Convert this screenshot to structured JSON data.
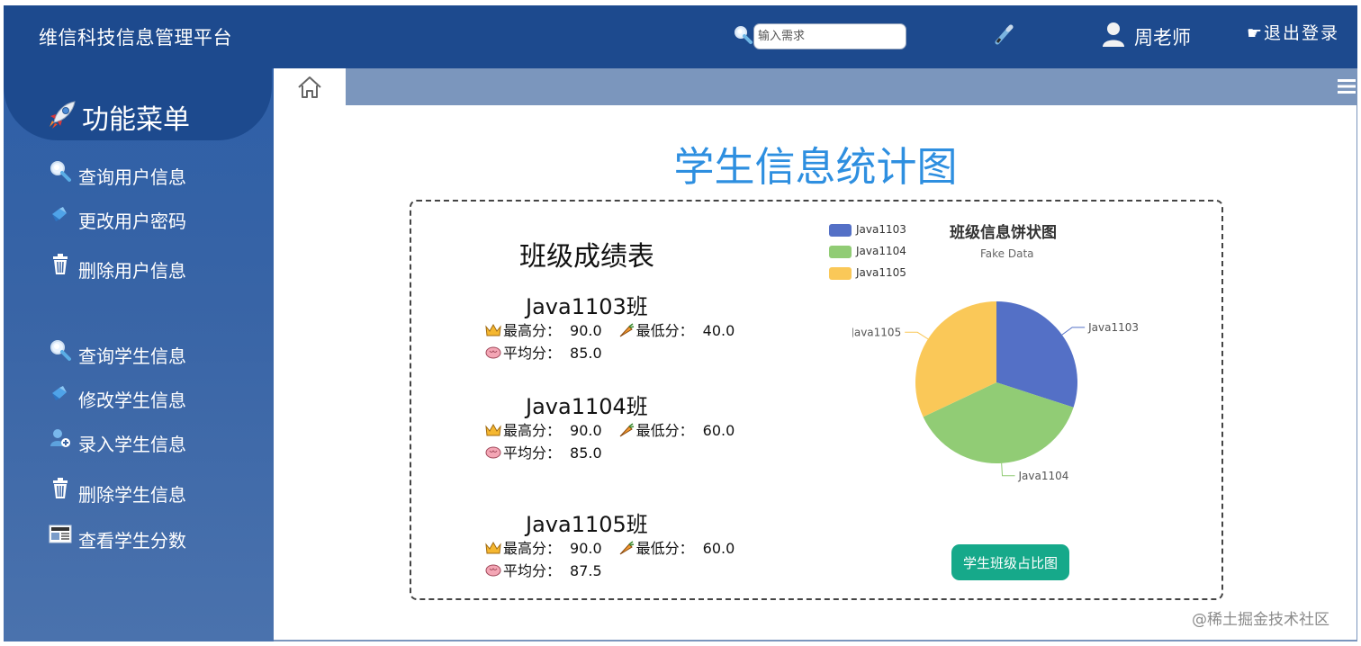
{
  "header": {
    "brand": "维信科技信息管理平台",
    "search_placeholder": "输入需求",
    "user_name": "周老师",
    "logout_label": "☛退出登录"
  },
  "sidebar": {
    "menu_title": "功能菜单",
    "items": [
      {
        "label": "查询用户信息",
        "icon": "magnifier-icon"
      },
      {
        "label": "更改用户密码",
        "icon": "key-icon"
      },
      {
        "label": "删除用户信息",
        "icon": "trash-icon"
      },
      {
        "label": "查询学生信息",
        "icon": "magnifier-icon"
      },
      {
        "label": "修改学生信息",
        "icon": "key-icon"
      },
      {
        "label": "录入学生信息",
        "icon": "add-user-icon"
      },
      {
        "label": "删除学生信息",
        "icon": "trash-icon"
      },
      {
        "label": "查看学生分数",
        "icon": "newspaper-icon"
      }
    ]
  },
  "main": {
    "page_title": "学生信息统计图",
    "score_table": {
      "title": "班级成绩表",
      "max_label": "最高分：",
      "min_label": "最低分：",
      "avg_label": "平均分：",
      "classes": [
        {
          "name": "Java1103班",
          "max": "90.0",
          "min": "40.0",
          "avg": "85.0"
        },
        {
          "name": "Java1104班",
          "max": "90.0",
          "min": "60.0",
          "avg": "85.0"
        },
        {
          "name": "Java1105班",
          "max": "90.0",
          "min": "60.0",
          "avg": "87.5"
        }
      ]
    },
    "pie_button": "学生班级占比图"
  },
  "chart_data": {
    "type": "pie",
    "title": "班级信息饼状图",
    "subtitle": "Fake Data",
    "legend_position": "top-left",
    "categories": [
      "Java1103",
      "Java1104",
      "Java1105"
    ],
    "values": [
      30,
      38,
      32
    ],
    "colors": [
      "#5470c6",
      "#91cc75",
      "#fac858"
    ]
  },
  "watermark": "@稀土掘金技术社区"
}
